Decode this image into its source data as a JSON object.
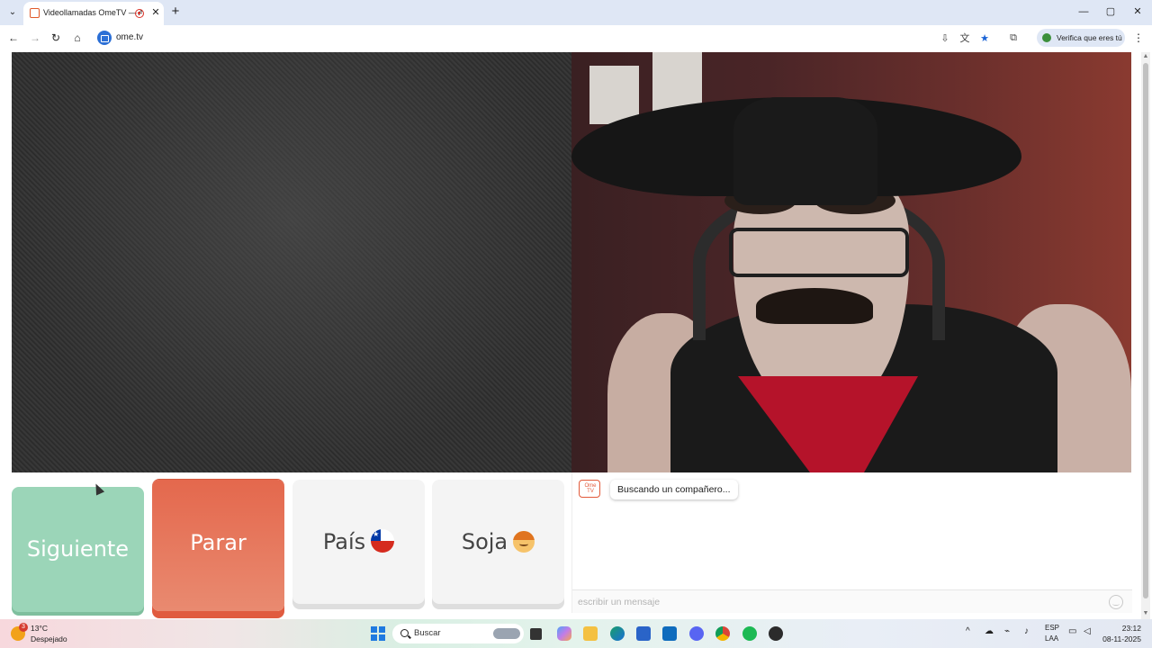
{
  "browser": {
    "tab_title": "Videollamadas OmeTV — A",
    "url": "ome.tv",
    "verify_label": "Verifica que eres tú",
    "tab_list_glyph": "⌄",
    "close_glyph": "✕",
    "newtab_glyph": "+",
    "minimize_glyph": "—",
    "maximize_glyph": "▢",
    "window_close_glyph": "✕",
    "back_glyph": "←",
    "forward_glyph": "→",
    "reload_glyph": "↻",
    "home_glyph": "⌂",
    "menu_glyph": "⋮"
  },
  "controls": {
    "next_label": "Siguiente",
    "stop_label": "Parar",
    "country_label": "País",
    "gender_label": "Soja"
  },
  "chat": {
    "logo_text": "Ome TV",
    "status_message": "Buscando un compañero...",
    "input_placeholder": "escribir un mensaje"
  },
  "taskbar": {
    "weather_badge": "3",
    "temperature": "13°C",
    "weather_desc": "Despejado",
    "search_label": "Buscar",
    "lang_top": "ESP",
    "lang_bottom": "LAA",
    "time": "23:12",
    "date": "08-11-2025"
  },
  "colors": {
    "next_button": "#9bd5b8",
    "stop_button": "#e4684d",
    "chip": "#2b6fd6"
  },
  "icons": {
    "tray": [
      "chevron-up-icon",
      "onedrive-icon",
      "network-icon",
      "microphone-icon",
      "display-icon",
      "volume-icon"
    ],
    "taskbar_apps": [
      "start-icon",
      "search-icon",
      "task-view-icon",
      "copilot-icon",
      "file-explorer-icon",
      "edge-icon",
      "store-icon",
      "outlook-icon",
      "discord-icon",
      "chrome-icon",
      "spotify-icon",
      "obs-icon"
    ]
  }
}
